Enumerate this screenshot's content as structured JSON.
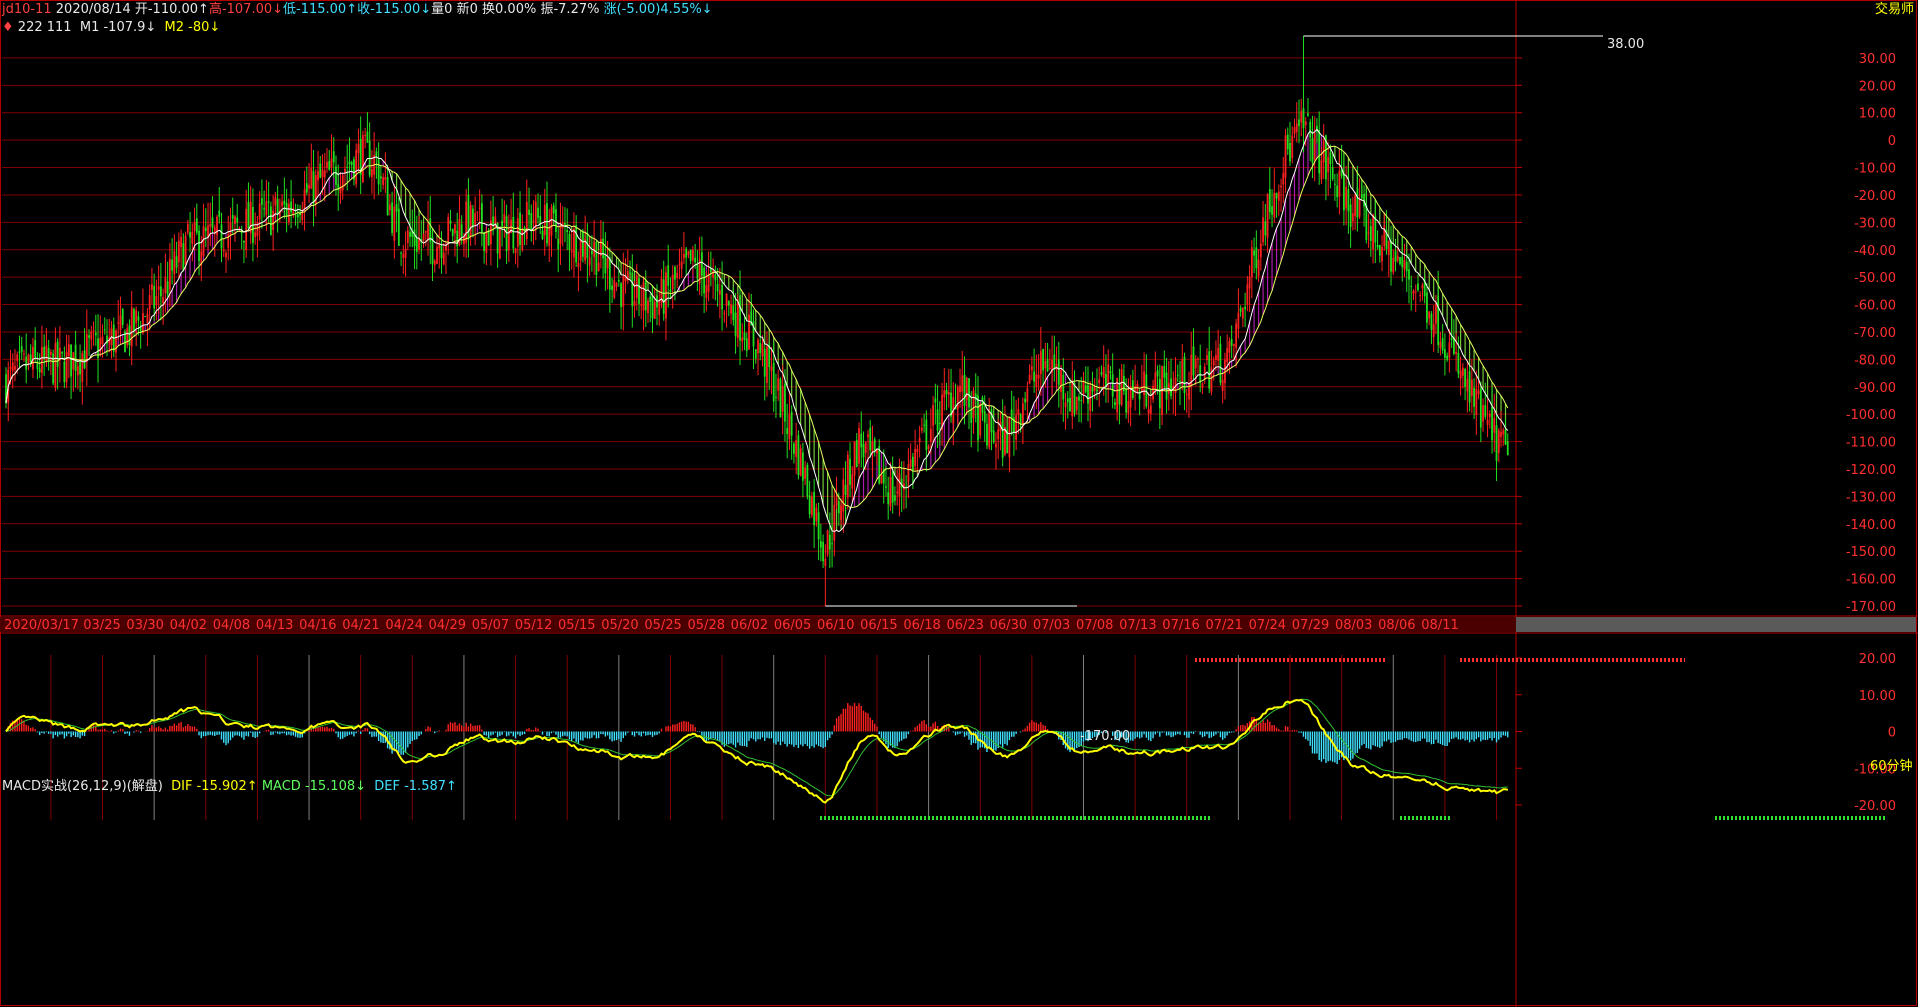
{
  "header": {
    "symbol": "jd10-11",
    "date": "2020/08/14",
    "open": "开-110.00↑",
    "high": "高-107.00↓",
    "low": "低-115.00↑",
    "close": "收-115.00↓",
    "volume": "量0",
    "new": "新0",
    "turnover": "换0.00%",
    "amplitude": "振-7.27%",
    "change": "涨(-5.00)4.55%↓",
    "corner_label": "交易师"
  },
  "indicator_line": {
    "marker": "♦",
    "a": "222",
    "b": "111",
    "m1": "M1 -107.9↓",
    "m2": "M2 -80↓"
  },
  "price_annotations": {
    "high": "38.00",
    "low": "-170.00"
  },
  "period_label": "60分钟",
  "macd_header": {
    "name": "MACD实战(26,12,9)(解盘)",
    "dif": "DIF -15.902↑",
    "macd": "MACD -15.108↓",
    "def": "DEF -1.587↑"
  },
  "colors": {
    "up": "#ff2020",
    "down": "#20e020",
    "ma_white": "#ffffff",
    "ma_yellow": "#e8ff60",
    "fill_up": "#c020c0",
    "fill_down": "#80e040",
    "grid": "#800000",
    "dif": "#ffff00",
    "macd_line": "#30c030",
    "hist_pos": "#ff2020",
    "hist_neg": "#40e0ff"
  },
  "chart_data": [
    {
      "type": "candlestick",
      "ylim": [
        -170,
        38
      ],
      "yticks": [
        "30.00",
        "20.00",
        "10.00",
        "0",
        "-10.00",
        "-20.00",
        "-30.00",
        "-40.00",
        "-50.00",
        "-60.00",
        "-70.00",
        "-80.00",
        "-90.00",
        "-100.00",
        "-110.00",
        "-120.00",
        "-130.00",
        "-140.00",
        "-150.00",
        "-160.00",
        "-170.00"
      ],
      "xticks": [
        "2020/03/17",
        "03/25",
        "03/30",
        "04/02",
        "04/08",
        "04/13",
        "04/16",
        "04/21",
        "04/24",
        "04/29",
        "05/07",
        "05/12",
        "05/15",
        "05/20",
        "05/25",
        "05/28",
        "06/02",
        "06/05",
        "06/10",
        "06/15",
        "06/18",
        "06/23",
        "06/30",
        "07/03",
        "07/08",
        "07/13",
        "07/16",
        "07/21",
        "07/24",
        "07/29",
        "08/03",
        "08/06",
        "08/11"
      ],
      "anchors": [
        [
          0,
          -88
        ],
        [
          10,
          -82
        ],
        [
          25,
          -82
        ],
        [
          40,
          -75
        ],
        [
          55,
          -70
        ],
        [
          70,
          -55
        ],
        [
          80,
          -38
        ],
        [
          95,
          -35
        ],
        [
          110,
          -30
        ],
        [
          125,
          -25
        ],
        [
          140,
          -15
        ],
        [
          150,
          -10
        ],
        [
          158,
          -5
        ],
        [
          165,
          -8
        ],
        [
          175,
          -35
        ],
        [
          190,
          -38
        ],
        [
          205,
          -30
        ],
        [
          220,
          -35
        ],
        [
          235,
          -28
        ],
        [
          250,
          -35
        ],
        [
          262,
          -40
        ],
        [
          275,
          -55
        ],
        [
          290,
          -60
        ],
        [
          305,
          -45
        ],
        [
          320,
          -58
        ],
        [
          335,
          -75
        ],
        [
          345,
          -95
        ],
        [
          355,
          -120
        ],
        [
          365,
          -150
        ],
        [
          372,
          -130
        ],
        [
          380,
          -110
        ],
        [
          388,
          -120
        ],
        [
          396,
          -130
        ],
        [
          405,
          -115
        ],
        [
          415,
          -100
        ],
        [
          425,
          -90
        ],
        [
          435,
          -105
        ],
        [
          445,
          -110
        ],
        [
          455,
          -90
        ],
        [
          465,
          -80
        ],
        [
          475,
          -95
        ],
        [
          485,
          -88
        ],
        [
          500,
          -92
        ],
        [
          515,
          -90
        ],
        [
          530,
          -85
        ],
        [
          545,
          -80
        ],
        [
          560,
          -30
        ],
        [
          570,
          -5
        ],
        [
          578,
          5
        ],
        [
          585,
          -5
        ],
        [
          592,
          -15
        ],
        [
          600,
          -25
        ],
        [
          610,
          -35
        ],
        [
          620,
          -45
        ],
        [
          630,
          -55
        ],
        [
          640,
          -70
        ],
        [
          650,
          -90
        ],
        [
          660,
          -105
        ],
        [
          669,
          -115
        ]
      ],
      "last_candle": {
        "open": -110.0,
        "high": -107.0,
        "low": -115.0,
        "close": -115.0
      },
      "extremes": {
        "high": 38.0,
        "low": -170.0
      },
      "series": [
        {
          "name": "M1",
          "last": -107.9
        },
        {
          "name": "M2",
          "last": -80
        }
      ]
    },
    {
      "type": "macd",
      "params": [
        26,
        12,
        9
      ],
      "ylim": [
        -20,
        20
      ],
      "yticks": [
        "20.00",
        "10.00",
        "0",
        "-10.00",
        "-20.00"
      ],
      "last": {
        "DIF": -15.902,
        "MACD": -15.108,
        "DEF": -1.587
      }
    }
  ]
}
